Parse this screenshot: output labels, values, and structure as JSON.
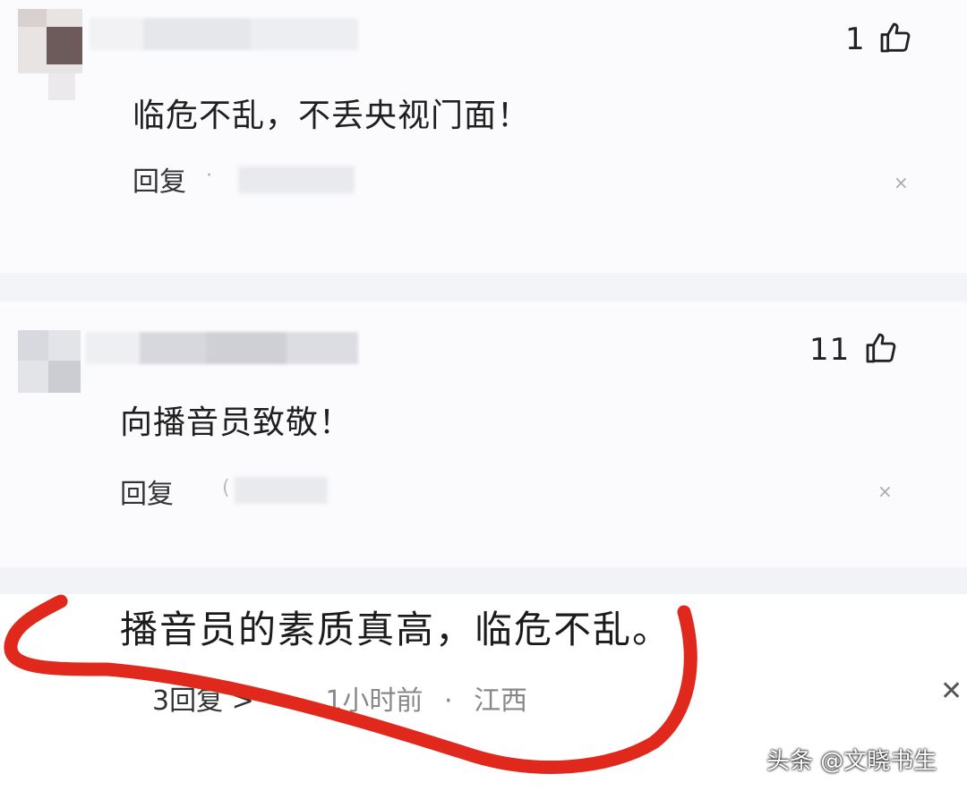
{
  "comments": [
    {
      "like_count": "1",
      "text": "临危不乱，不丢央视门面！",
      "reply_label": "回复"
    },
    {
      "like_count": "11",
      "text": "向播音员致敬！",
      "reply_label": "回复",
      "mention_prefix": "("
    },
    {
      "text": "播音员的素质真高，临危不乱。",
      "replies_label": "3回复",
      "replies_chevron": ">",
      "time": "1小时前",
      "separator": "·",
      "location": "江西",
      "close_glyph": "✕"
    }
  ],
  "watermark": "头条 @文晓书生",
  "annotation_color": "#e0281c",
  "icons": {
    "like": "thumbs-up-icon",
    "close": "close-icon"
  }
}
